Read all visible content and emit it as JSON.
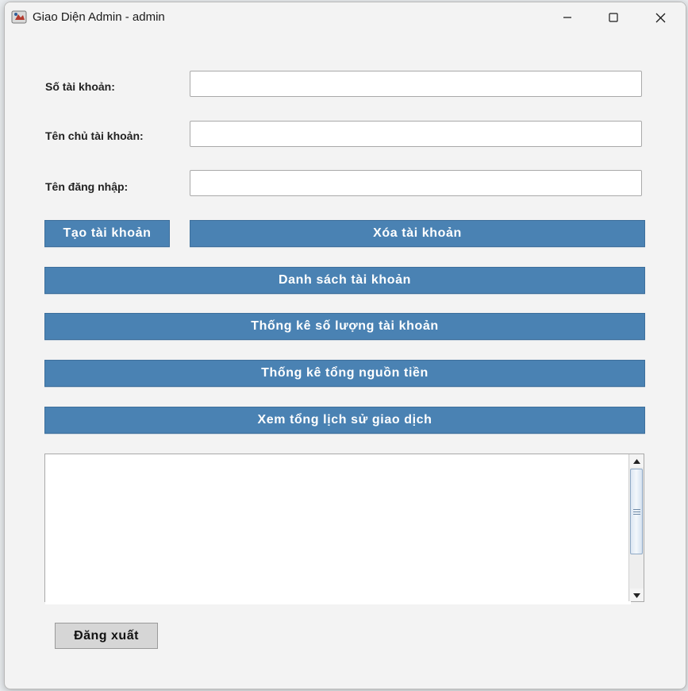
{
  "window": {
    "title": "Giao Diện Admin - admin",
    "icon": "java-app-icon",
    "controls": {
      "minimize_icon": "minimize-icon",
      "maximize_icon": "maximize-icon",
      "close_icon": "close-icon"
    }
  },
  "form": {
    "account_number_label": "Số tài khoản:",
    "account_number_value": "",
    "owner_name_label": "Tên chủ tài khoản:",
    "owner_name_value": "",
    "username_label": "Tên đăng nhập:",
    "username_value": ""
  },
  "actions": {
    "create_account": "Tạo tài khoản",
    "delete_account": "Xóa tài khoản",
    "list_accounts": "Danh sách tài khoản",
    "count_accounts": "Thống kê số lượng tài khoản",
    "total_funds": "Thống kê tổng nguồn tiền",
    "transaction_history": "Xem tổng lịch sử giao dịch"
  },
  "output": {
    "text": ""
  },
  "logout": {
    "label": "Đăng xuất"
  },
  "colors": {
    "primary_button": "#4a82b3",
    "secondary_button": "#d6d6d6",
    "window_background": "#f3f3f3"
  }
}
